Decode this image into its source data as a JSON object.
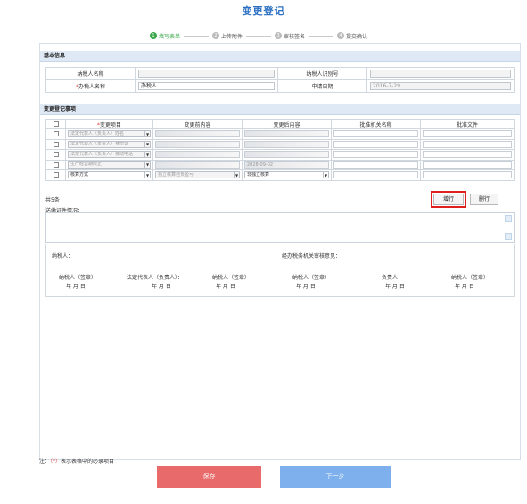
{
  "page": {
    "title": "变更登记"
  },
  "steps": [
    {
      "num": "1",
      "label": "填写表单",
      "active": true
    },
    {
      "num": "2",
      "label": "上传附件",
      "active": false
    },
    {
      "num": "3",
      "label": "审核签名",
      "active": false
    },
    {
      "num": "4",
      "label": "提交确认",
      "active": false
    }
  ],
  "basic": {
    "section_title": "基本信息",
    "taxpayer_name_label": "纳税人名称",
    "taxpayer_id_label": "纳税人识别号",
    "handler_label": "办税人名称",
    "handler_value": "办税人",
    "apply_date_label": "申请日期",
    "apply_date_value": "2016-7-29"
  },
  "change": {
    "section_title": "变更登记事项",
    "headers": [
      "",
      "变更项目",
      "变更前内容",
      "变更后内容",
      "批准机关名称",
      "批准文件"
    ],
    "rows": [
      {
        "item": "法定代表人（负责人）姓名",
        "before": "",
        "after": ""
      },
      {
        "item": "法定代表人（负责人）身份证",
        "before": "",
        "after": ""
      },
      {
        "item": "法定代表人（负责人）移动电话",
        "before": "",
        "after": ""
      },
      {
        "item": "生产经营期限止",
        "before": "",
        "after": "2028-09-02"
      },
      {
        "item": "核算方式",
        "before": "独立核算自负盈亏",
        "after": "非独立核算"
      }
    ]
  },
  "count_text": "共5条",
  "add_row_label": "增行",
  "delete_row_label": "删行",
  "reason_label": "送缴证件情况：",
  "sign": {
    "left_title": "纳税人：",
    "right_title": "经办税务机关审核意见：",
    "left_cols": [
      "纳税人（签章）：",
      "法定代表人（负责人）：",
      "纳税人（签章）"
    ],
    "right_cols": [
      "纳税人（签章）",
      "负责人：",
      "纳税人（签章）"
    ],
    "date_text": "年   月   日"
  },
  "note": "注：（*）表示表格中的必录项目",
  "buttons": {
    "save": "保存",
    "next": "下一步"
  },
  "colors": {
    "title": "#2b6fc2",
    "active_step": "#3aa84a",
    "save": "#e86a6a",
    "next": "#7db0ec",
    "highlight": "#e01f1f"
  }
}
